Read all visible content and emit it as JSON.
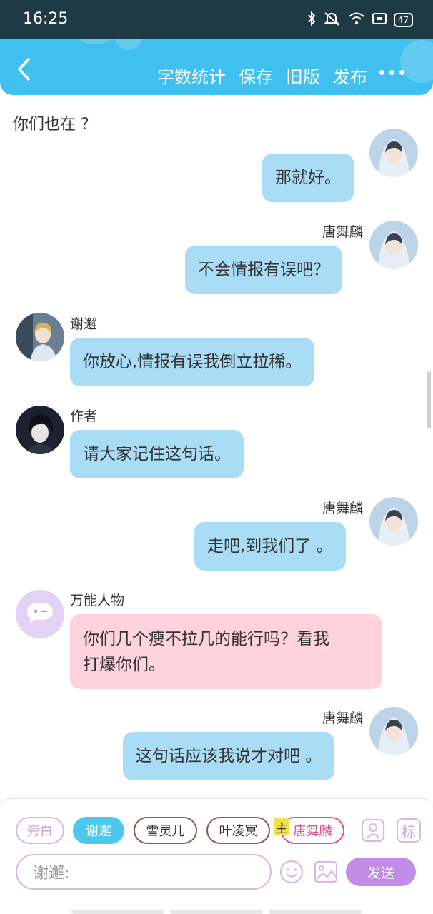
{
  "status_bar": {
    "time": "16:25",
    "battery": "47"
  },
  "toolbar": {
    "actions": [
      "字数统计",
      "保存",
      "旧版",
      "发布"
    ]
  },
  "chat": {
    "plain_line": "你们也在 ？",
    "messages": [
      {
        "side": "right",
        "name": "",
        "text": "那就好。",
        "avatar": "tang-avatar"
      },
      {
        "side": "right",
        "name": "唐舞麟",
        "text": "不会情报有误吧？",
        "avatar": "tang-avatar"
      },
      {
        "side": "left",
        "name": "谢邂",
        "text": "你放心,情报有误我倒立拉稀。",
        "avatar": "xie-avatar"
      },
      {
        "side": "left",
        "name": "作者",
        "text": "请大家记住这句话。",
        "avatar": "author-avatar"
      },
      {
        "side": "right",
        "name": "唐舞麟",
        "text": "走吧,到我们了 。",
        "avatar": "tang-avatar"
      },
      {
        "side": "left",
        "name": "万能人物",
        "text_line1": "你们几个瘦不拉几的能行吗？看我",
        "text_line2": "打爆你们。",
        "avatar": "universal-avatar"
      },
      {
        "side": "right",
        "name": "唐舞麟",
        "text": "这句话应该我说才对吧 。",
        "avatar": "tang-avatar"
      }
    ]
  },
  "composer": {
    "chips": [
      {
        "label": "旁白",
        "color": "#d9b8e8",
        "text_color": "#c9a0dc"
      },
      {
        "label": "谢邂",
        "color": "#4cc8ee",
        "text_color": "#ffffff"
      },
      {
        "label": "雪灵儿",
        "color": "#8a5a4a",
        "text_color": "#333333"
      },
      {
        "label": "叶凌冥",
        "color": "#8a5a4a",
        "text_color": "#333333"
      },
      {
        "label": "唐舞麟",
        "color": "#e0508a",
        "text_color": "#e0508a"
      }
    ],
    "main_badge": "主",
    "role_icon": "标",
    "input_placeholder": "谢邂:",
    "send_label": "发送"
  },
  "colors": {
    "header": "#3fc0ee",
    "bubble_blue": "#a9dcf5",
    "bubble_pink": "#ffd2dc",
    "send": "#c18ce6"
  }
}
